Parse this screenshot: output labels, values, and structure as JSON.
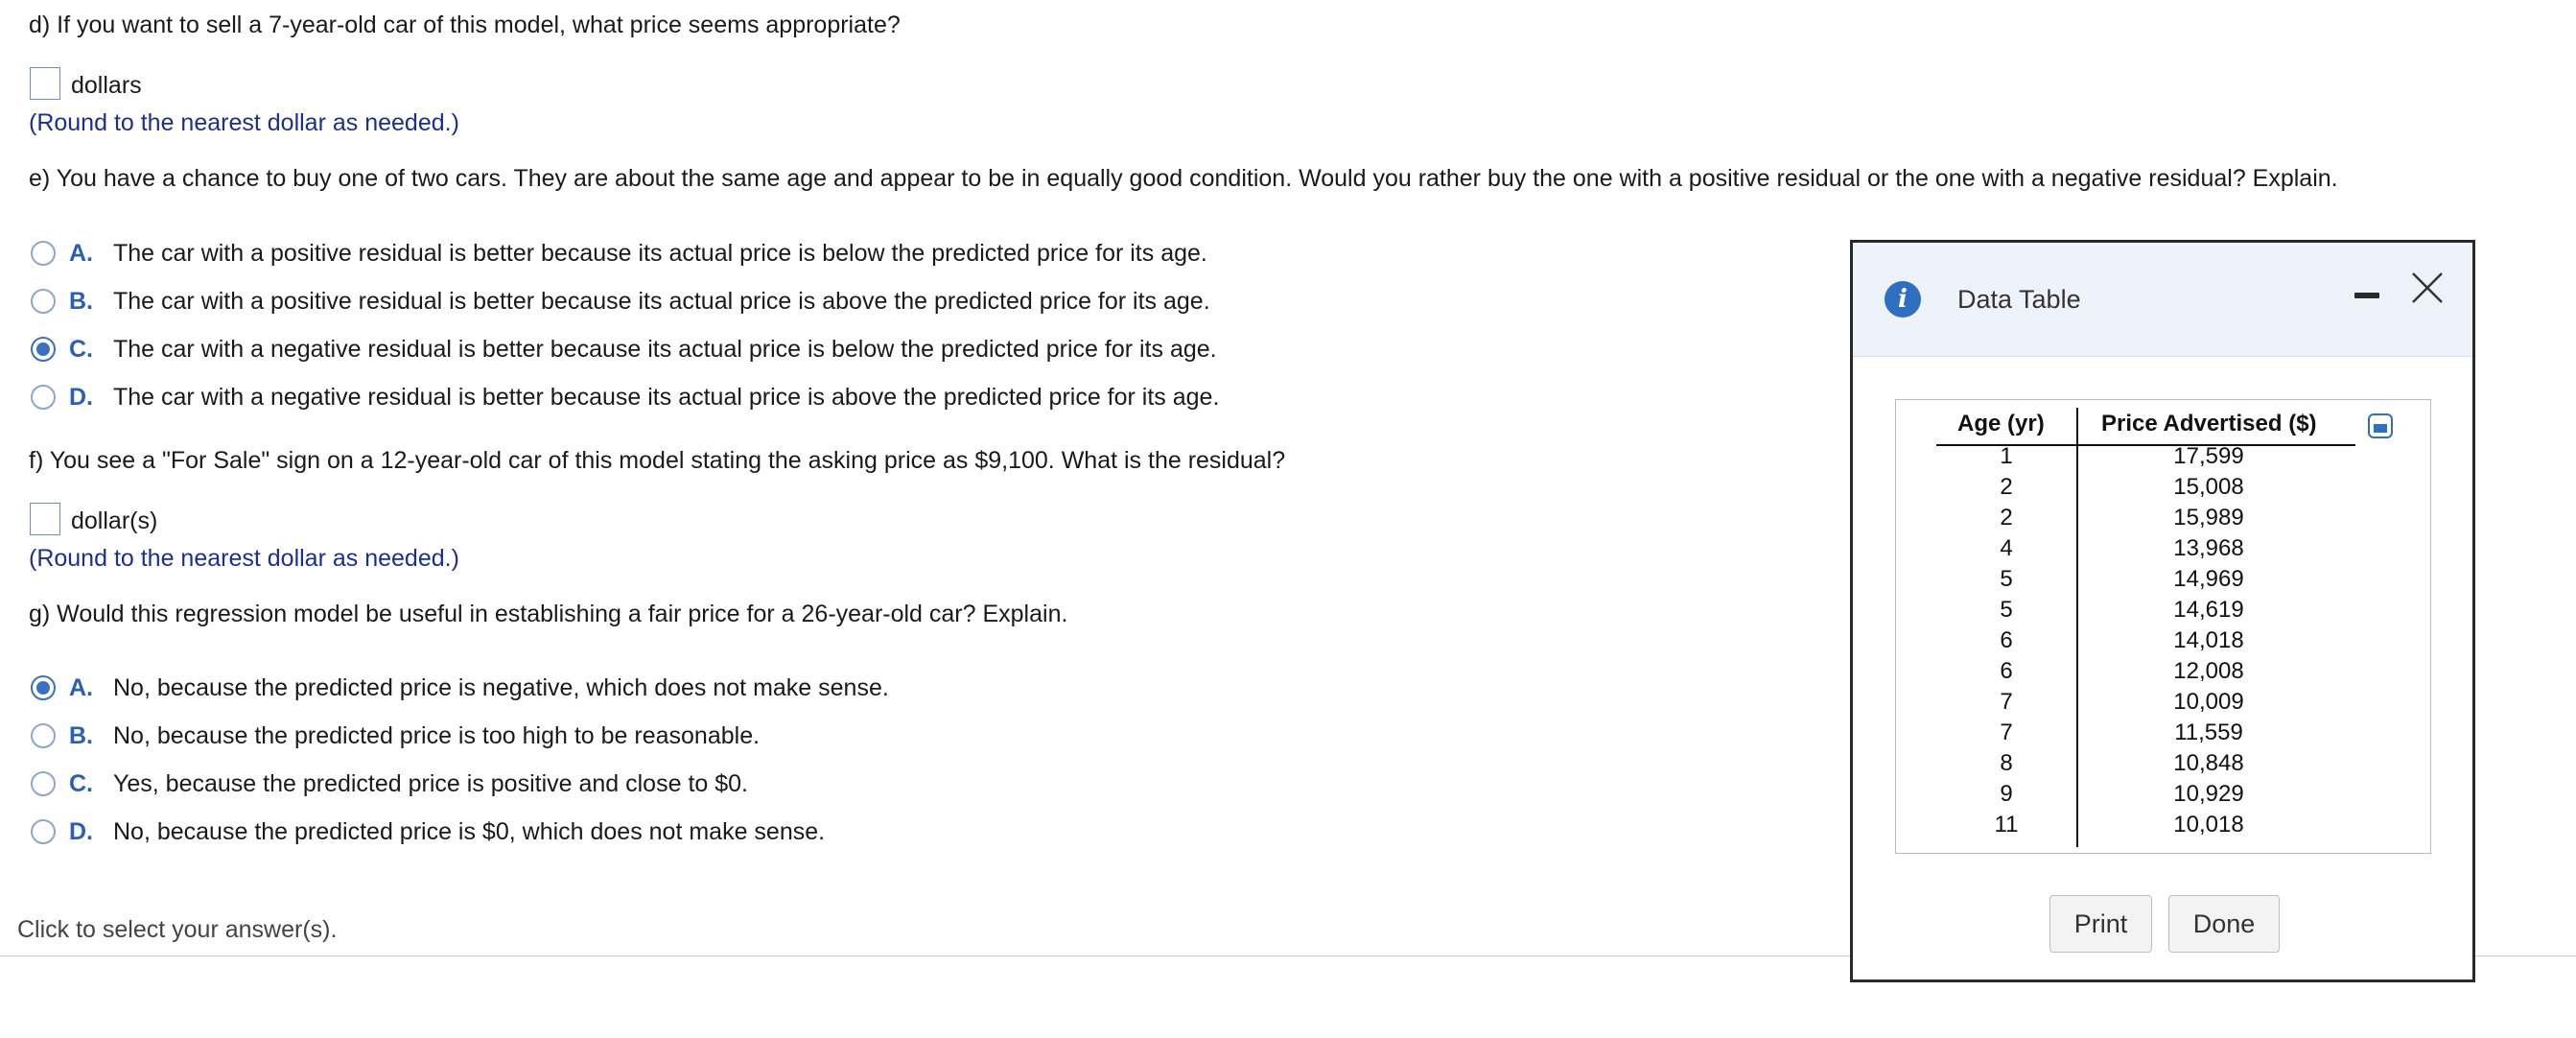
{
  "question_d": {
    "prompt": "d) If you want to sell a 7-year-old car of this model, what price seems appropriate?",
    "unit": "dollars",
    "hint": "(Round to the nearest dollar as needed.)"
  },
  "question_e": {
    "prompt": "e) You have a chance to buy one of two cars. They are about the same age and appear to be in equally good condition. Would you rather buy the one with a positive residual or the one with a negative residual? Explain.",
    "options": [
      {
        "letter": "A.",
        "text": "The car with a positive residual is better because its actual price is below the predicted price for its age.",
        "selected": false
      },
      {
        "letter": "B.",
        "text": "The car with a positive residual is better because its actual price is above the predicted price for its age.",
        "selected": false
      },
      {
        "letter": "C.",
        "text": "The car with a negative residual is better because its actual price is below the predicted price for its age.",
        "selected": true
      },
      {
        "letter": "D.",
        "text": "The car with a negative residual is better because its actual price is above the predicted price for its age.",
        "selected": false
      }
    ]
  },
  "question_f": {
    "prompt": "f) You see a \"For Sale\" sign on a 12-year-old car of this model stating the asking price as $9,100. What is the residual?",
    "unit": "dollar(s)",
    "hint": "(Round to the nearest dollar as needed.)"
  },
  "question_g": {
    "prompt": "g) Would this regression model be useful in establishing a fair price for a 26-year-old car? Explain.",
    "options": [
      {
        "letter": "A.",
        "text": "No, because the predicted price is negative, which does not make sense.",
        "selected": true
      },
      {
        "letter": "B.",
        "text": "No, because the predicted price is too high to be reasonable.",
        "selected": false
      },
      {
        "letter": "C.",
        "text": "Yes, because the predicted price is positive and close to $0.",
        "selected": false
      },
      {
        "letter": "D.",
        "text": "No, because the predicted price is $0, which does not make sense.",
        "selected": false
      }
    ]
  },
  "footer": {
    "instruction": "Click to select your answer(s)."
  },
  "dialog": {
    "title": "Data Table",
    "columns": [
      "Age (yr)",
      "Price Advertised ($)"
    ],
    "rows": [
      [
        "1",
        "17,599"
      ],
      [
        "2",
        "15,008"
      ],
      [
        "2",
        "15,989"
      ],
      [
        "4",
        "13,968"
      ],
      [
        "5",
        "14,969"
      ],
      [
        "5",
        "14,619"
      ],
      [
        "6",
        "14,018"
      ],
      [
        "6",
        "12,008"
      ],
      [
        "7",
        "10,009"
      ],
      [
        "7",
        "11,559"
      ],
      [
        "8",
        "10,848"
      ],
      [
        "9",
        "10,929"
      ],
      [
        "11",
        "10,018"
      ]
    ],
    "print_label": "Print",
    "done_label": "Done"
  }
}
